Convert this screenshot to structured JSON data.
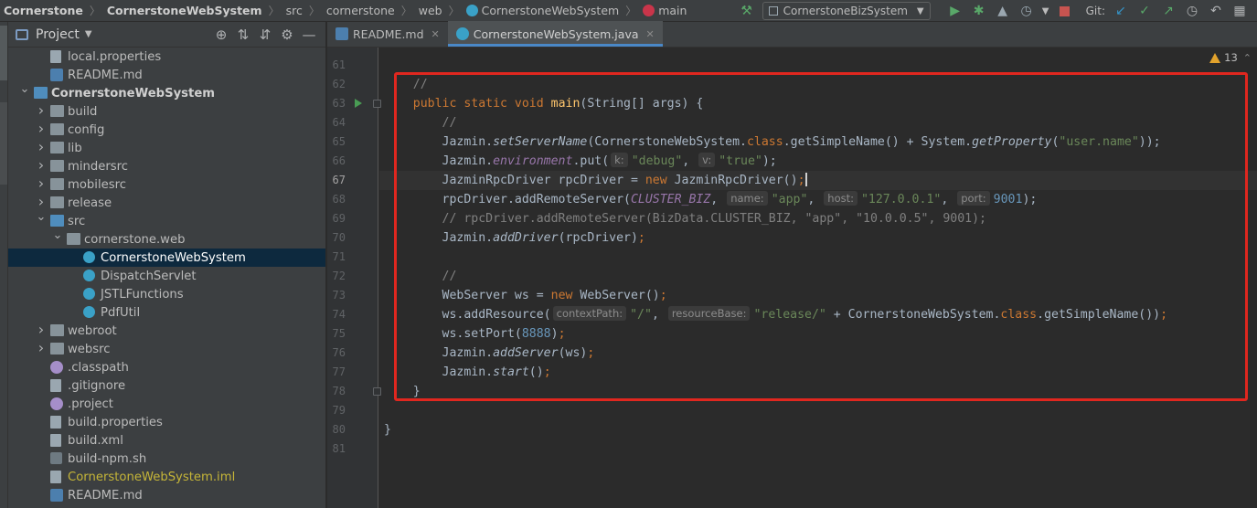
{
  "breadcrumbs": {
    "items": [
      {
        "label": "Cornerstone",
        "bold": true
      },
      {
        "label": "CornerstoneWebSystem",
        "bold": true
      },
      {
        "label": "src"
      },
      {
        "label": "cornerstone"
      },
      {
        "label": "web"
      },
      {
        "label": "CornerstoneWebSystem",
        "icon": "class-icon"
      },
      {
        "label": "main",
        "icon": "method-icon"
      }
    ]
  },
  "toolbar": {
    "run_config": "CornerstoneBizSystem",
    "git_label": "Git:",
    "icons": [
      "build-hammer-icon",
      "run-icon",
      "debug-icon",
      "coverage-icon",
      "profile-icon",
      "stop-icon",
      "git-update-icon",
      "git-commit-icon",
      "git-push-icon",
      "history-icon",
      "rollback-icon",
      "vcs-window-icon"
    ]
  },
  "project_panel": {
    "title": "Project",
    "tree": [
      {
        "label": "local.properties",
        "icon": "file",
        "depth": 3
      },
      {
        "label": "README.md",
        "icon": "md",
        "depth": 3
      },
      {
        "label": "CornerstoneWebSystem",
        "icon": "project",
        "depth": 2,
        "expanded": true,
        "bold": true
      },
      {
        "label": "build",
        "icon": "folder",
        "depth": 3,
        "collapsed": true
      },
      {
        "label": "config",
        "icon": "folder",
        "depth": 3,
        "collapsed": true
      },
      {
        "label": "lib",
        "icon": "folder",
        "depth": 3,
        "collapsed": true
      },
      {
        "label": "mindersrc",
        "icon": "folder",
        "depth": 3,
        "collapsed": true
      },
      {
        "label": "mobilesrc",
        "icon": "folder",
        "depth": 3,
        "collapsed": true
      },
      {
        "label": "release",
        "icon": "folder",
        "depth": 3,
        "collapsed": true
      },
      {
        "label": "src",
        "icon": "folder-src",
        "depth": 3,
        "expanded": true
      },
      {
        "label": "cornerstone.web",
        "icon": "pkg",
        "depth": 4,
        "expanded": true
      },
      {
        "label": "CornerstoneWebSystem",
        "icon": "class",
        "depth": 5,
        "selected": true
      },
      {
        "label": "DispatchServlet",
        "icon": "class",
        "depth": 5
      },
      {
        "label": "JSTLFunctions",
        "icon": "class",
        "depth": 5
      },
      {
        "label": "PdfUtil",
        "icon": "class",
        "depth": 5
      },
      {
        "label": "webroot",
        "icon": "folder",
        "depth": 3,
        "collapsed": true
      },
      {
        "label": "websrc",
        "icon": "folder",
        "depth": 3,
        "collapsed": true
      },
      {
        "label": ".classpath",
        "icon": "eclipse",
        "depth": 3
      },
      {
        "label": ".gitignore",
        "icon": "git",
        "depth": 3
      },
      {
        "label": ".project",
        "icon": "eclipse",
        "depth": 3
      },
      {
        "label": "build.properties",
        "icon": "file",
        "depth": 3
      },
      {
        "label": "build.xml",
        "icon": "file",
        "depth": 3
      },
      {
        "label": "build-npm.sh",
        "icon": "shell",
        "depth": 3
      },
      {
        "label": "CornerstoneWebSystem.iml",
        "icon": "file",
        "depth": 3,
        "yellow": true
      },
      {
        "label": "README.md",
        "icon": "md",
        "depth": 3
      }
    ]
  },
  "tabs": [
    {
      "label": "README.md",
      "icon": "md",
      "active": false
    },
    {
      "label": "CornerstoneWebSystem.java",
      "icon": "class",
      "active": true
    }
  ],
  "editor": {
    "warning_count": "13",
    "current_line": 67,
    "lines": [
      {
        "n": 61,
        "tokens": []
      },
      {
        "n": 62,
        "tokens": [
          {
            "t": "    //",
            "c": "cmt"
          }
        ]
      },
      {
        "n": 63,
        "tokens": [
          {
            "t": "    "
          },
          {
            "t": "public static void ",
            "c": "kw"
          },
          {
            "t": "main",
            "c": "fn"
          },
          {
            "t": "(String[] args) {"
          }
        ]
      },
      {
        "n": 64,
        "tokens": [
          {
            "t": "        //",
            "c": "cmt"
          }
        ]
      },
      {
        "n": 65,
        "tokens": [
          {
            "t": "        Jazmin."
          },
          {
            "t": "setServerName",
            "c": "it"
          },
          {
            "t": "(CornerstoneWebSystem."
          },
          {
            "t": "class",
            "c": "kw"
          },
          {
            "t": ".getSimpleName() + System."
          },
          {
            "t": "getProperty",
            "c": "it"
          },
          {
            "t": "("
          },
          {
            "t": "\"user.name\"",
            "c": "str"
          },
          {
            "t": "));"
          }
        ]
      },
      {
        "n": 66,
        "tokens": [
          {
            "t": "        Jazmin."
          },
          {
            "t": "environment",
            "c": "field"
          },
          {
            "t": ".put("
          },
          {
            "hint": "k:"
          },
          {
            "t": "\"debug\"",
            "c": "str"
          },
          {
            "t": ", "
          },
          {
            "hint": "v:"
          },
          {
            "t": "\"true\"",
            "c": "str"
          },
          {
            "t": ");"
          }
        ]
      },
      {
        "n": 67,
        "tokens": [
          {
            "t": "        JazminRpcDriver rpcDriver = "
          },
          {
            "t": "new ",
            "c": "kw"
          },
          {
            "t": "JazminRpcDriver()"
          },
          {
            "t": ";",
            "c": "kw"
          },
          {
            "caret": true
          }
        ]
      },
      {
        "n": 68,
        "tokens": [
          {
            "t": "        rpcDriver.addRemoteServer("
          },
          {
            "t": "CLUSTER_BIZ",
            "c": "field"
          },
          {
            "t": ", "
          },
          {
            "hint": "name:"
          },
          {
            "t": "\"app\"",
            "c": "str"
          },
          {
            "t": ", "
          },
          {
            "hint": "host:"
          },
          {
            "t": "\"127.0.0.1\"",
            "c": "str"
          },
          {
            "t": ", "
          },
          {
            "hint": "port:"
          },
          {
            "t": "9001",
            "c": "num"
          },
          {
            "t": ");"
          }
        ]
      },
      {
        "n": 69,
        "tokens": [
          {
            "t": "        // rpcDriver.addRemoteServer(BizData.CLUSTER_BIZ, \"app\", \"10.0.0.5\", 9001);",
            "c": "cmt"
          }
        ]
      },
      {
        "n": 70,
        "tokens": [
          {
            "t": "        Jazmin."
          },
          {
            "t": "addDriver",
            "c": "it"
          },
          {
            "t": "(rpcDriver)"
          },
          {
            "t": ";",
            "c": "kw"
          }
        ]
      },
      {
        "n": 71,
        "tokens": []
      },
      {
        "n": 72,
        "tokens": [
          {
            "t": "        //",
            "c": "cmt"
          }
        ]
      },
      {
        "n": 73,
        "tokens": [
          {
            "t": "        WebServer ws = "
          },
          {
            "t": "new ",
            "c": "kw"
          },
          {
            "t": "WebServer()"
          },
          {
            "t": ";",
            "c": "kw"
          }
        ]
      },
      {
        "n": 74,
        "tokens": [
          {
            "t": "        ws.addResource("
          },
          {
            "hint": "contextPath:"
          },
          {
            "t": "\"/\"",
            "c": "str"
          },
          {
            "t": ", "
          },
          {
            "hint": "resourceBase:"
          },
          {
            "t": "\"release/\"",
            "c": "str"
          },
          {
            "t": " + CornerstoneWebSystem."
          },
          {
            "t": "class",
            "c": "kw"
          },
          {
            "t": ".getSimpleName())"
          },
          {
            "t": ";",
            "c": "kw"
          }
        ]
      },
      {
        "n": 75,
        "tokens": [
          {
            "t": "        ws.setPort("
          },
          {
            "t": "8888",
            "c": "num"
          },
          {
            "t": ")"
          },
          {
            "t": ";",
            "c": "kw"
          }
        ]
      },
      {
        "n": 76,
        "tokens": [
          {
            "t": "        Jazmin."
          },
          {
            "t": "addServer",
            "c": "it"
          },
          {
            "t": "(ws)"
          },
          {
            "t": ";",
            "c": "kw"
          }
        ]
      },
      {
        "n": 77,
        "tokens": [
          {
            "t": "        Jazmin."
          },
          {
            "t": "start",
            "c": "it"
          },
          {
            "t": "()"
          },
          {
            "t": ";",
            "c": "kw"
          }
        ]
      },
      {
        "n": 78,
        "tokens": [
          {
            "t": "    }"
          }
        ]
      },
      {
        "n": 79,
        "tokens": []
      },
      {
        "n": 80,
        "tokens": [
          {
            "t": "}"
          }
        ]
      },
      {
        "n": 81,
        "tokens": []
      }
    ]
  },
  "colors": {
    "highlight_box": "#e0271f",
    "selection": "#0d293e",
    "keyword": "#cc7832",
    "string": "#6a8759",
    "number": "#6897bb"
  }
}
